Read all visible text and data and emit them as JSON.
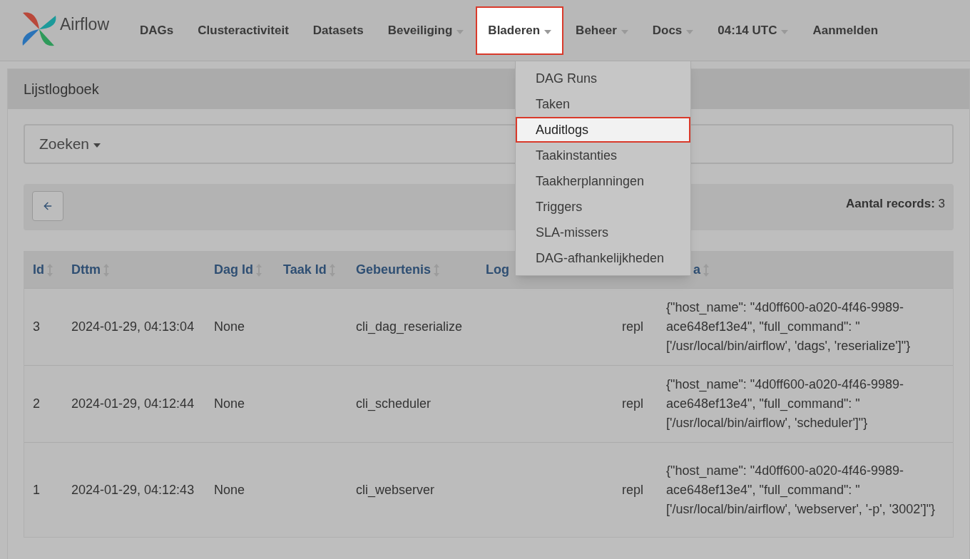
{
  "brand": "Airflow",
  "nav": [
    {
      "label": "DAGs",
      "dropdown": false,
      "selected": false
    },
    {
      "label": "Clusteractiviteit",
      "dropdown": false,
      "selected": false
    },
    {
      "label": "Datasets",
      "dropdown": false,
      "selected": false
    },
    {
      "label": "Beveiliging",
      "dropdown": true,
      "selected": false
    },
    {
      "label": "Bladeren",
      "dropdown": true,
      "selected": true
    },
    {
      "label": "Beheer",
      "dropdown": true,
      "selected": false
    },
    {
      "label": "Docs",
      "dropdown": true,
      "selected": false
    },
    {
      "label": "04:14 UTC",
      "dropdown": true,
      "selected": false
    },
    {
      "label": "Aanmelden",
      "dropdown": false,
      "selected": false
    }
  ],
  "menu": {
    "items": [
      {
        "label": "DAG Runs",
        "selected": false
      },
      {
        "label": "Taken",
        "selected": false
      },
      {
        "label": "Auditlogs",
        "selected": true
      },
      {
        "label": "Taakinstanties",
        "selected": false
      },
      {
        "label": "Taakherplanningen",
        "selected": false
      },
      {
        "label": "Triggers",
        "selected": false
      },
      {
        "label": "SLA-missers",
        "selected": false
      },
      {
        "label": "DAG-afhankelijkheden",
        "selected": false
      }
    ]
  },
  "panel": {
    "title": "Lijstlogboek",
    "search_button": "Zoeken",
    "record_count": {
      "label": "Aantal records:",
      "value": "3"
    }
  },
  "table": {
    "columns": [
      {
        "label": "Id",
        "sortable": true
      },
      {
        "label": "Dttm",
        "sortable": true
      },
      {
        "label": "Dag Id",
        "sortable": true
      },
      {
        "label": "Taak Id",
        "sortable": true
      },
      {
        "label": "Gebeurtenis",
        "sortable": true
      },
      {
        "label": "Log"
      },
      {},
      {
        "label": "a",
        "sortable": true
      }
    ],
    "rows": [
      [
        "3",
        "2024-01-29, 04:13:04",
        "None",
        null,
        "cli_dag_reserialize",
        null,
        "repl",
        "{\"host_name\": \"4d0ff600-a020-4f46-9989-ace648ef13e4\", \"full_command\": \"['/usr/local/bin/airflow', 'dags', 'reserialize']\"}"
      ],
      [
        "2",
        "2024-01-29, 04:12:44",
        "None",
        null,
        "cli_scheduler",
        null,
        "repl",
        "{\"host_name\": \"4d0ff600-a020-4f46-9989-ace648ef13e4\", \"full_command\": \"['/usr/local/bin/airflow', 'scheduler']\"}"
      ],
      [
        "1",
        "2024-01-29, 04:12:43",
        "None",
        null,
        "cli_webserver",
        null,
        "repl",
        "{\"host_name\": \"4d0ff600-a020-4f46-9989-ace648ef13e4\", \"full_command\": \"['/usr/local/bin/airflow', 'webserver', '-p', '3002']\"}"
      ]
    ]
  }
}
